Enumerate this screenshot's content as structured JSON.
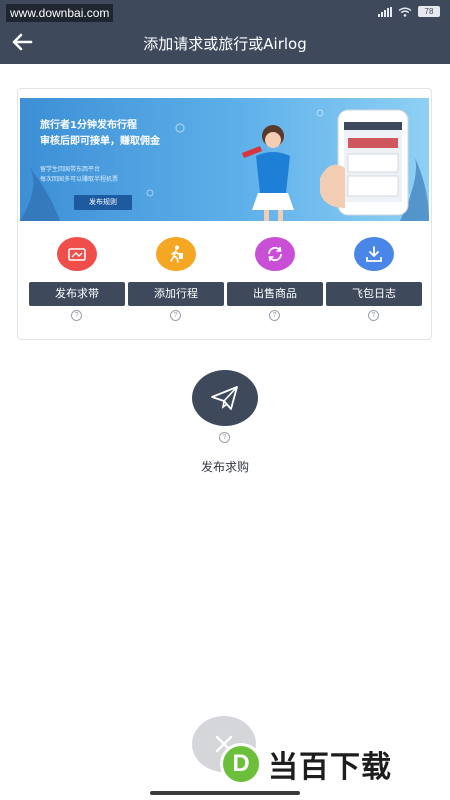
{
  "status_bar": {
    "watermark": "www.downbai.com",
    "battery": "78"
  },
  "header": {
    "title": "添加请求或旅行或Airlog"
  },
  "banner": {
    "line1": "旅行者1分钟发布行程",
    "line2": "审核后即可接单，赚取佣金",
    "line3": "留学生回国带东西平台",
    "line4": "每次回国多可以赚取半程机票",
    "button": "发布规则"
  },
  "features": [
    {
      "label": "发布求带",
      "icon": "gift-icon",
      "color": "#f04e4a"
    },
    {
      "label": "添加行程",
      "icon": "walker-icon",
      "color": "#f5a623"
    },
    {
      "label": "出售商品",
      "icon": "refresh-icon",
      "color": "#c94fd6"
    },
    {
      "label": "飞包日志",
      "icon": "download-icon",
      "color": "#4a86e8"
    }
  ],
  "help_glyph": "?",
  "publish": {
    "label": "发布求购",
    "icon": "paper-plane-icon"
  },
  "bottom_watermark": {
    "logo_letter": "D",
    "text": "当百下载"
  },
  "colors": {
    "header": "#3e4a5c",
    "accent": "#3e4a5c"
  }
}
